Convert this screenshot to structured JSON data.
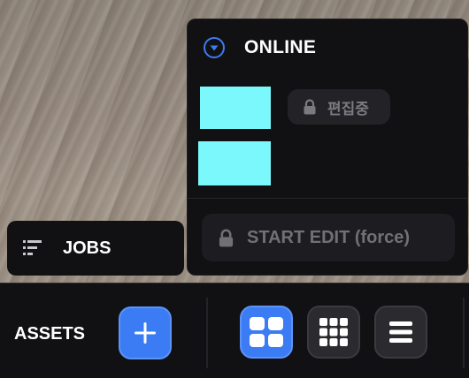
{
  "online_panel": {
    "title": "ONLINE",
    "icon": "chevron-down-circle-icon",
    "swatch_color": "#7af8fb",
    "editing_badge": {
      "label": "편집중",
      "icon": "lock-icon"
    },
    "start_edit_button": {
      "label": "START EDIT (force)",
      "icon": "lock-icon"
    }
  },
  "jobs_panel": {
    "label": "JOBS",
    "icon": "task-list-icon"
  },
  "toolbar": {
    "assets_label": "ASSETS",
    "add_button_icon": "plus-icon",
    "view_modes": [
      {
        "name": "large-grid",
        "icon": "large-grid-icon",
        "active": true
      },
      {
        "name": "small-grid",
        "icon": "small-grid-icon",
        "active": false
      },
      {
        "name": "list",
        "icon": "list-icon",
        "active": false
      }
    ]
  },
  "colors": {
    "accent": "#3b7cf5",
    "panel": "#111113"
  }
}
